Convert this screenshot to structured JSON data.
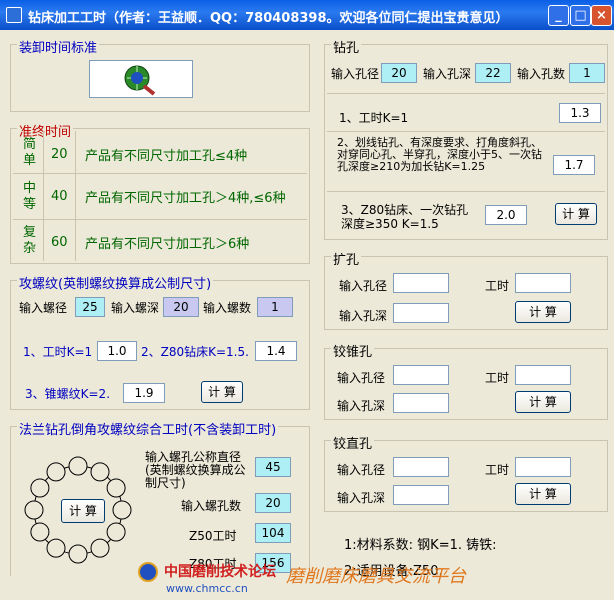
{
  "window": {
    "title": "钻床加工工时（作者：王益顺．QQ：780408398。欢迎各位同仁提出宝贵意见）"
  },
  "zhuangxie": {
    "title": "装卸时间标准"
  },
  "zhunzhong": {
    "title": "准终时间",
    "rows": [
      {
        "level": "简单",
        "minutes": "20",
        "desc": "产品有不同尺寸加工孔≤4种"
      },
      {
        "level": "中等",
        "minutes": "40",
        "desc": "产品有不同尺寸加工孔＞4种,≤6种"
      },
      {
        "level": "复杂",
        "minutes": "60",
        "desc": "产品有不同尺寸加工孔＞6种"
      }
    ]
  },
  "gongluowen": {
    "title": "攻螺纹(英制螺纹换算成公制尺寸)",
    "dia_label": "输入螺径",
    "dia": "25",
    "depth_label": "输入螺深",
    "depth": "20",
    "count_label": "输入螺数",
    "count": "1",
    "k1_label": "1、工时K=1",
    "k1": "1.0",
    "k2_label": "2、Z80钻床K=1.5.",
    "k2": "1.4",
    "k3_label": "3、锥螺纹K=2.",
    "k3": "1.9",
    "calc": "计 算"
  },
  "falan": {
    "title": "法兰钻孔倒角攻螺纹综合工时(不含装卸工时)",
    "nominal_label": "输入螺孔公称直径(英制螺纹换算成公制尺寸)",
    "nominal": "45",
    "count_label": "输入螺孔数",
    "count": "20",
    "z50_label": "Z50工时",
    "z50": "104",
    "z80_label": "Z80工时",
    "z80": "156",
    "calc": "计 算"
  },
  "zuankong": {
    "title": "钻孔",
    "dia_label": "输入孔径",
    "dia": "20",
    "depth_label": "输入孔深",
    "depth": "22",
    "count_label": "输入孔数",
    "count": "1",
    "k1_label": "1、工时K=1",
    "k1": "1.3",
    "k2_label": "2、划线钻孔、有深度要求、打角度斜孔、对穿同心孔、半穿孔，深度小于5、一次钻孔深度≥210为加长钻K=1.25",
    "k2": "1.7",
    "k3_label": "3、Z80钻床、一次钻孔深度≥350 K=1.5",
    "k3": "2.0",
    "calc": "计 算"
  },
  "kuokong": {
    "title": "扩孔",
    "dia_label": "输入孔径",
    "depth_label": "输入孔深",
    "time_label": "工时",
    "calc": "计 算"
  },
  "jiaozhui": {
    "title": "铰锥孔",
    "dia_label": "输入孔径",
    "depth_label": "输入孔深",
    "time_label": "工时",
    "calc": "计 算"
  },
  "jiaozhi": {
    "title": "铰直孔",
    "dia_label": "输入孔径",
    "depth_label": "输入孔深",
    "time_label": "工时",
    "calc": "计 算"
  },
  "notes": {
    "line1": "1:材料系数: 钢K=1. 铸铁:",
    "line2": "2:适用设备:Z50."
  },
  "watermark": {
    "left": "中国磨削技术论坛",
    "url": "www.chmcc.cn",
    "right": "磨削磨床磨具交流平台"
  }
}
